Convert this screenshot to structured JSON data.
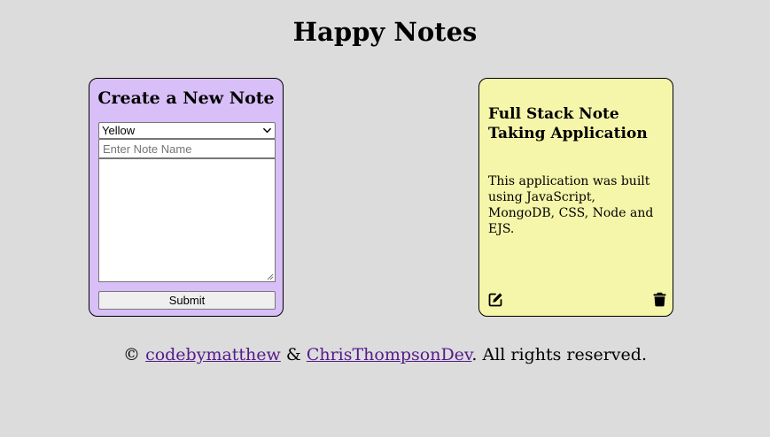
{
  "header": {
    "title": "Happy Notes"
  },
  "create_note": {
    "title": "Create a New Note",
    "color_select": {
      "selected": "Yellow"
    },
    "name_input": {
      "value": "",
      "placeholder": "Enter Note Name"
    },
    "body_textarea": {
      "value": ""
    },
    "submit_label": "Submit",
    "background": "#d8bff7"
  },
  "notes": [
    {
      "title": "Full Stack Note Taking Application",
      "body": "This application was built using JavaScript, MongoDB, CSS, Node and EJS.",
      "color": "#f6f6aa",
      "actions": {
        "edit_icon": "edit-icon",
        "delete_icon": "trash-icon"
      }
    }
  ],
  "footer": {
    "copyright": "© ",
    "author1": "codebymatthew",
    "separator": " & ",
    "author2": "ChrisThompsonDev",
    "suffix": ". All rights reserved.",
    "link_color": "#551a8b"
  },
  "colors": {
    "page_background": "#dcdcdc"
  }
}
